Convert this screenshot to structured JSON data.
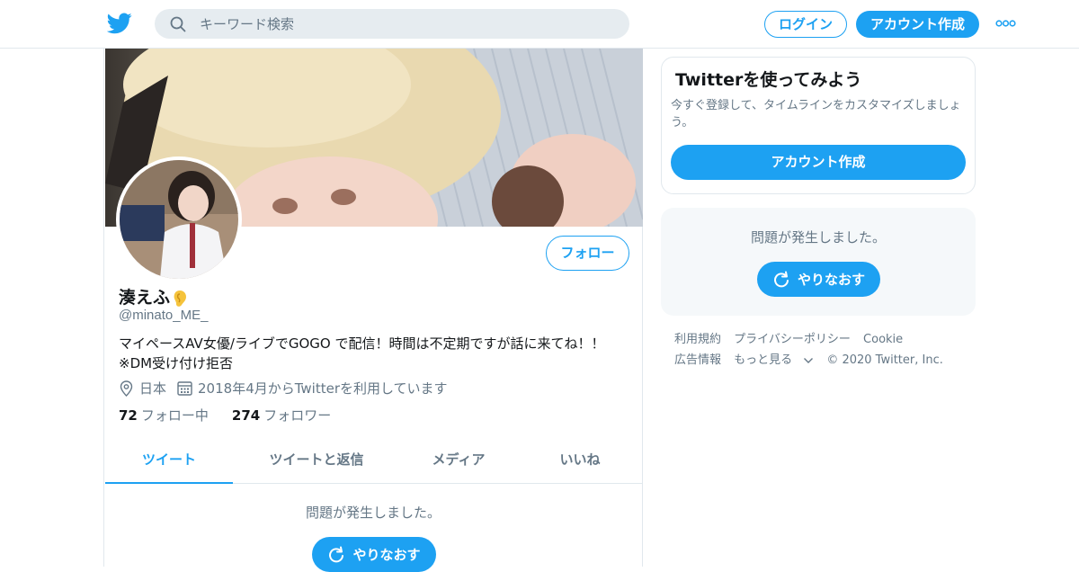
{
  "nav": {
    "search_placeholder": "キーワード検索",
    "login_label": "ログイン",
    "signup_label": "アカウント作成"
  },
  "profile": {
    "name": "湊えふ",
    "handle": "@minato_ME_",
    "bio_line1": "マイペースAV女優/ライブでGOGO で配信！時間は不定期ですが話に来てね！！",
    "bio_line2": "※DM受け付け拒否",
    "location": "日本",
    "joined": "2018年4月からTwitterを利用しています",
    "following_count": "72",
    "following_label": "フォロー中",
    "followers_count": "274",
    "followers_label": "フォロワー",
    "follow_button": "フォロー"
  },
  "tabs": [
    {
      "label": "ツイート",
      "active": true
    },
    {
      "label": "ツイートと返信",
      "active": false
    },
    {
      "label": "メディア",
      "active": false
    },
    {
      "label": "いいね",
      "active": false
    }
  ],
  "timeline": {
    "error_text": "問題が発生しました。",
    "retry_label": "やりなおす"
  },
  "sidebar": {
    "promo_title": "Twitterを使ってみよう",
    "promo_text": "今すぐ登録して、タイムラインをカスタマイズしましょう。",
    "promo_button": "アカウント作成",
    "error_text": "問題が発生しました。",
    "retry_label": "やりなおす",
    "footer_links": [
      "利用規約",
      "プライバシーポリシー",
      "Cookie",
      "広告情報",
      "もっと見る"
    ],
    "copyright": "© 2020 Twitter, Inc."
  },
  "colors": {
    "accent": "#1da1f2",
    "muted": "#657786",
    "border": "#e1e8ed",
    "panel": "#f5f8fa"
  }
}
